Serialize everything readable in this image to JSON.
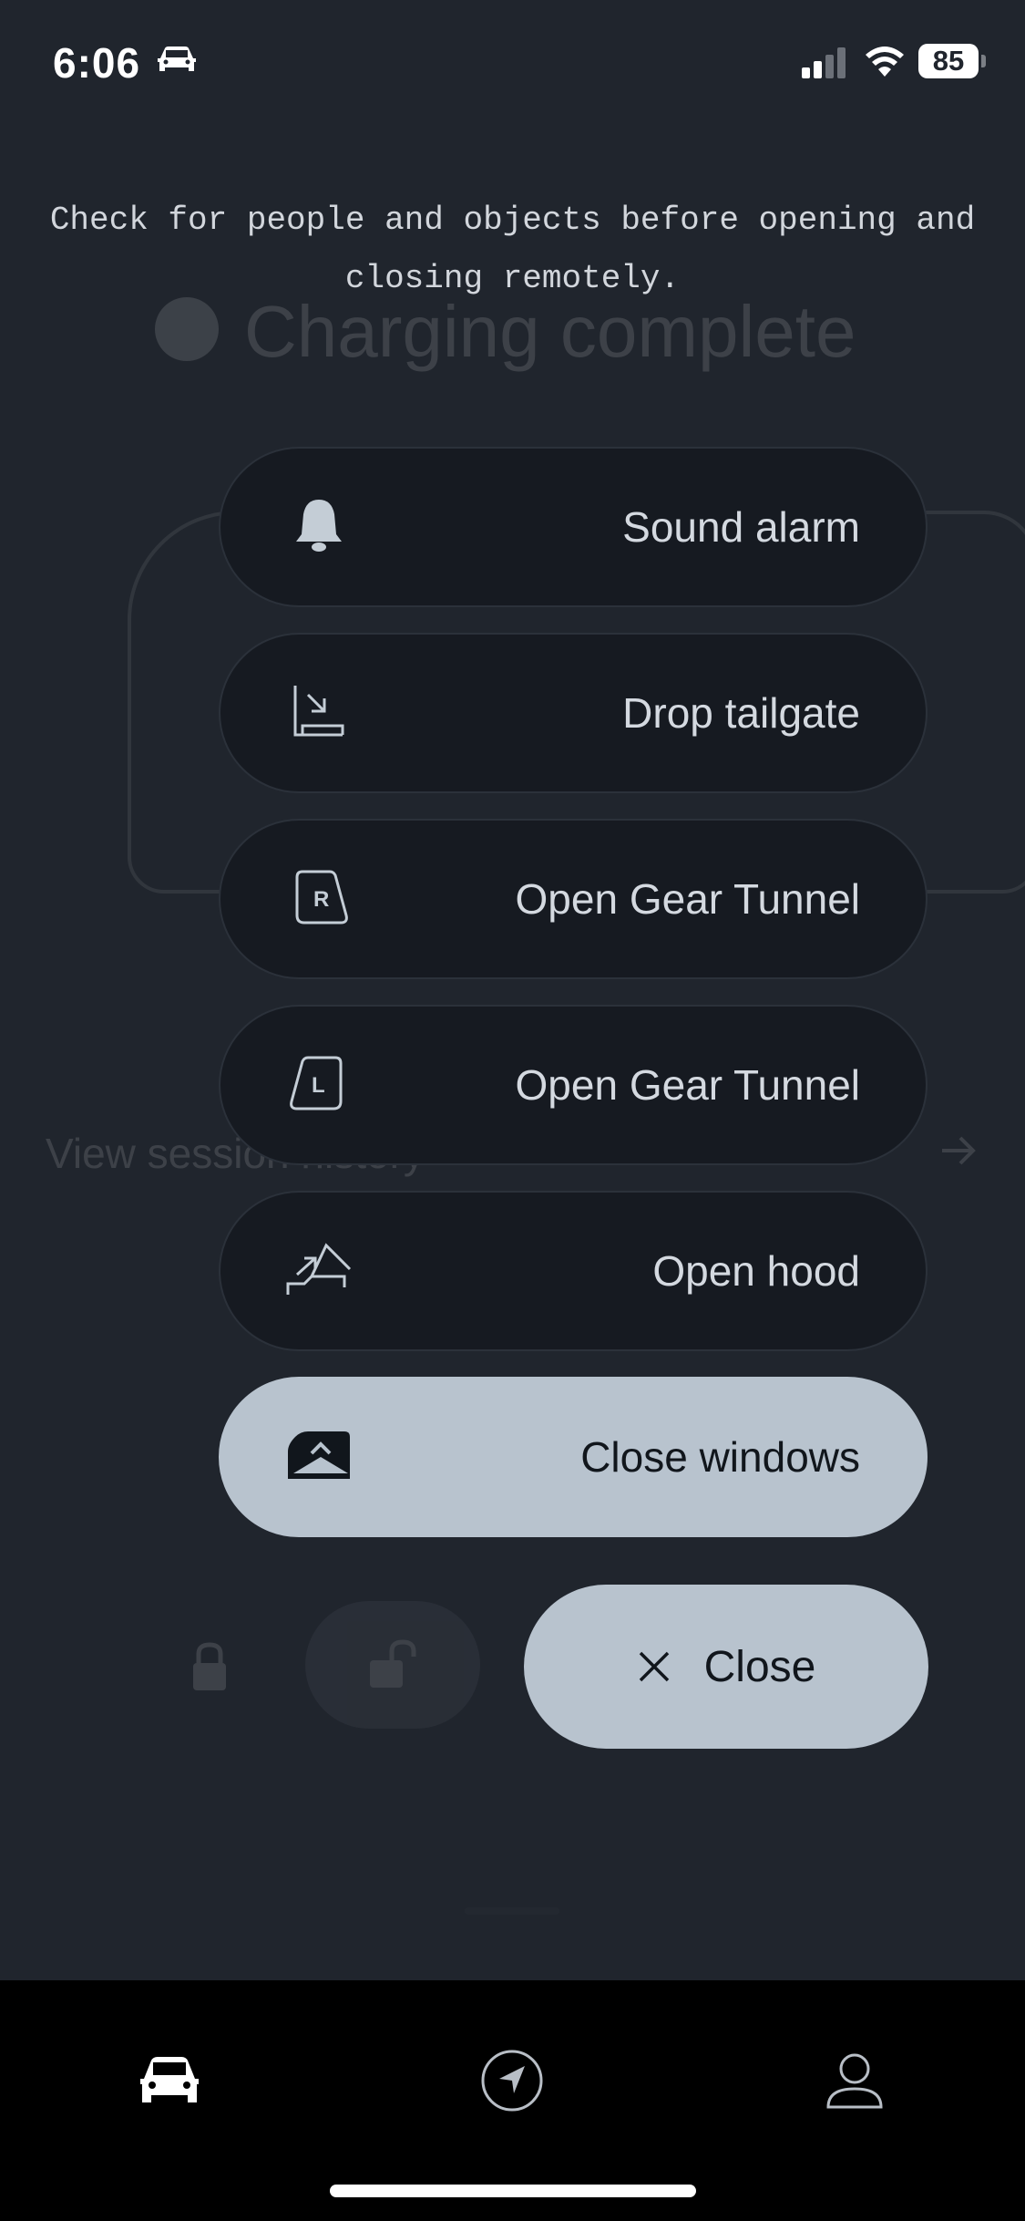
{
  "status_bar": {
    "time": "6:06",
    "battery": "85"
  },
  "background": {
    "charging_status": "Charging complete",
    "session_link": "View session history"
  },
  "warning": "Check for people and objects before opening and closing remotely.",
  "actions": [
    {
      "label": "Sound alarm",
      "icon": "bell-icon"
    },
    {
      "label": "Drop tailgate",
      "icon": "tailgate-icon"
    },
    {
      "label": "Open Gear Tunnel",
      "icon": "gear-tunnel-right-icon",
      "icon_letter": "R"
    },
    {
      "label": "Open Gear Tunnel",
      "icon": "gear-tunnel-left-icon",
      "icon_letter": "L"
    },
    {
      "label": "Open hood",
      "icon": "hood-icon"
    },
    {
      "label": "Close windows",
      "icon": "window-icon"
    }
  ],
  "close_button": {
    "label": "Close"
  },
  "tabs": [
    {
      "name": "vehicle",
      "icon": "car-icon",
      "active": true
    },
    {
      "name": "navigation",
      "icon": "navigation-icon",
      "active": false
    },
    {
      "name": "profile",
      "icon": "profile-icon",
      "active": false
    }
  ],
  "colors": {
    "background": "#20252d",
    "action_dark": "#161a21",
    "action_light": "#b8c3ce",
    "tabbar": "#000000"
  }
}
